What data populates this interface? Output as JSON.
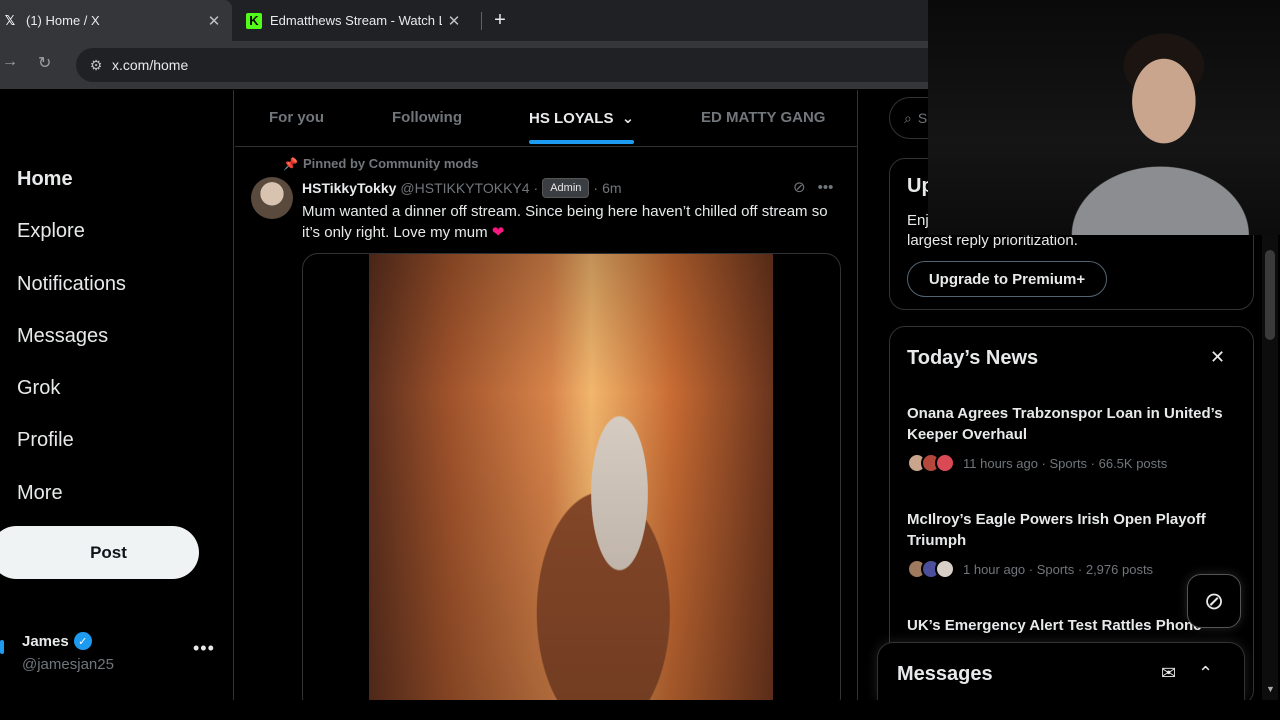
{
  "browser": {
    "tabs": [
      {
        "title": "(1) Home / X",
        "favicon": "x-logo-icon"
      },
      {
        "title": "Edmatthews Stream - Watch Live",
        "favicon": "kick-logo-icon"
      }
    ],
    "url": "x.com/home"
  },
  "nav": {
    "items": [
      "Home",
      "Explore",
      "Notifications",
      "Messages",
      "Grok",
      "Profile",
      "More"
    ],
    "post_label": "Post",
    "account": {
      "name": "James",
      "handle": "@jamesjan25"
    }
  },
  "community_tabs": [
    "For you",
    "Following",
    "HS LOYALS",
    "ED MATTY GANG"
  ],
  "post": {
    "pinned_label": "Pinned by Community mods",
    "author": "HSTikkyTokky",
    "handle": "@HSTIKKYTOKKY4",
    "badge": "Admin",
    "time": "6m",
    "text": "Mum wanted a dinner off stream. Since being here haven’t chilled off stream so it’s only right. Love my mum"
  },
  "right": {
    "search_placeholder": "S",
    "premium": {
      "title": "Up",
      "desc_line1": "Enj",
      "desc_line2": "largest reply prioritization.",
      "button": "Upgrade to Premium+"
    },
    "news": {
      "title": "Today’s News",
      "items": [
        {
          "headline": "Onana Agrees Trabzonspor Loan in United’s Keeper Overhaul",
          "meta": "11 hours ago · Sports · 66.5K posts"
        },
        {
          "headline": "McIlroy’s Eagle Powers Irish Open Playoff Triumph",
          "meta": "1 hour ago · Sports · 2,976 posts"
        },
        {
          "headline": "UK’s Emergency Alert Test Rattles Phone",
          "meta": ""
        }
      ]
    },
    "messages_label": "Messages"
  },
  "colors": {
    "accent": "#1d9bf0",
    "background": "#000000",
    "text": "#e7e9ea",
    "muted": "#71767b",
    "heart": "#f91880"
  }
}
